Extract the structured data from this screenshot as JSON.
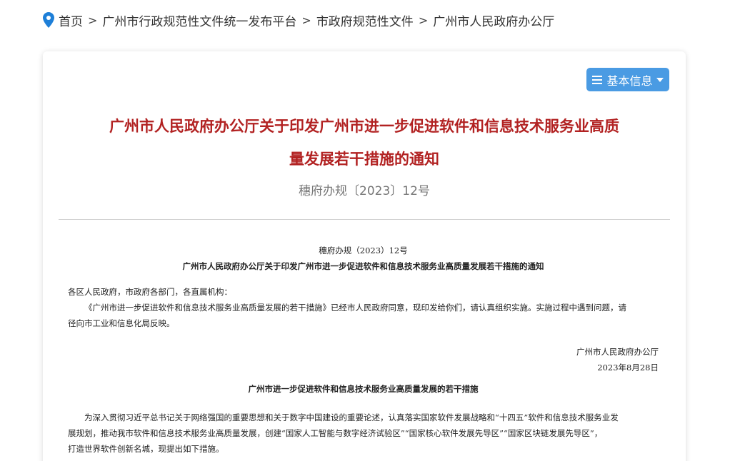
{
  "breadcrumb": {
    "items": [
      "首页",
      "广州市行政规范性文件统一发布平台",
      "市政府规范性文件",
      "广州市人民政府办公厅"
    ],
    "separator": ">"
  },
  "info_button": {
    "label": "基本信息"
  },
  "document": {
    "title_line1": "广州市人民政府办公厅关于印发广州市进一步促进软件和信息技术服务业高质",
    "title_line2": "量发展若干措施的通知",
    "number": "穗府办规〔2023〕12号",
    "body": {
      "number": "穗府办规（2023）12号",
      "heading": "广州市人民政府办公厅关于印发广州市进一步促进软件和信息技术服务业高质量发展若干措施的通知",
      "salutation": "各区人民政府，市政府各部门，各直属机构：",
      "paragraph1_line1": "《广州市进一步促进软件和信息技术服务业高质量发展的若干措施》已经市人民政府同意，现印发给你们，请认真组织实施。实施过程中遇到问题，请",
      "paragraph1_line2": "径向市工业和信息化局反映。",
      "issuer": "广州市人民政府办公厅",
      "date": "2023年8月28日",
      "subheading": "广州市进一步促进软件和信息技术服务业高质量发展的若干措施",
      "paragraph2_line1": "为深入贯彻习近平总书记关于网络强国的重要思想和关于数字中国建设的重要论述，认真落实国家软件发展战略和“十四五”软件和信息技术服务业发",
      "paragraph2_line2": "展规划，推动我市软件和信息技术服务业高质量发展，创建“国家人工智能与数字经济试验区”“国家核心软件发展先导区”“国家区块链发展先导区”，",
      "paragraph2_line3": "打造世界软件创新名城，现提出如下措施。"
    }
  },
  "colors": {
    "title": "#b22222",
    "button": "#4a9be3",
    "pin": "#1e7fd8"
  },
  "icons": {
    "location": "location-pin-icon",
    "menu": "menu-bars-icon",
    "caret": "caret-down-icon"
  }
}
